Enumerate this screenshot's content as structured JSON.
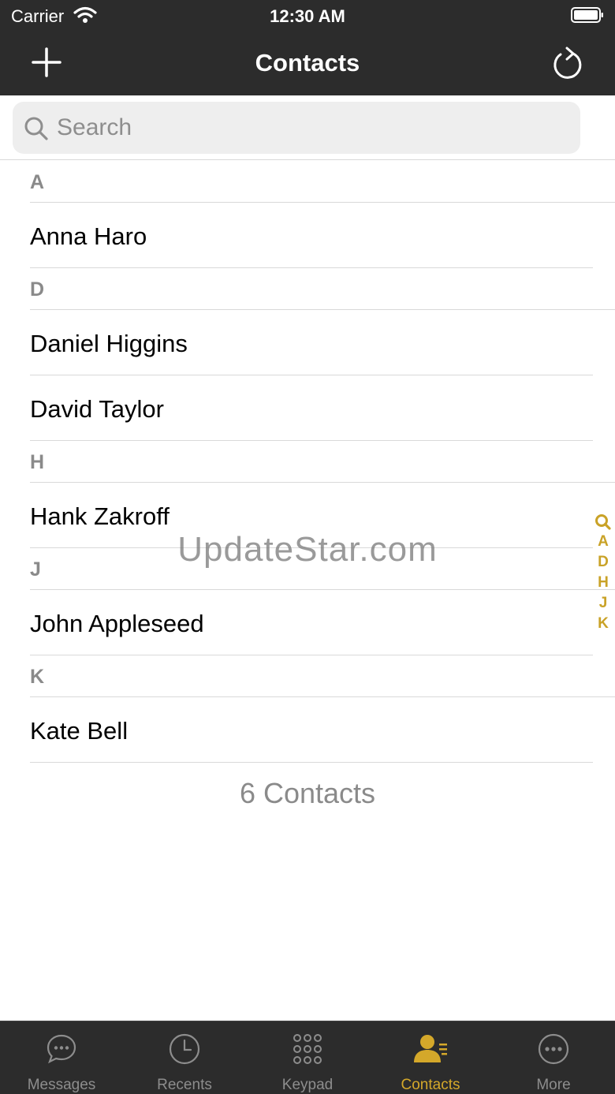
{
  "status_bar": {
    "carrier": "Carrier",
    "time": "12:30 AM"
  },
  "nav": {
    "title": "Contacts"
  },
  "search": {
    "placeholder": "Search",
    "value": ""
  },
  "sections": [
    {
      "letter": "A",
      "contacts": [
        "Anna Haro"
      ]
    },
    {
      "letter": "D",
      "contacts": [
        "Daniel Higgins",
        "David Taylor"
      ]
    },
    {
      "letter": "H",
      "contacts": [
        "Hank Zakroff"
      ]
    },
    {
      "letter": "J",
      "contacts": [
        "John Appleseed"
      ]
    },
    {
      "letter": "K",
      "contacts": [
        "Kate Bell"
      ]
    }
  ],
  "footer": {
    "count_label": "6 Contacts"
  },
  "index_letters": [
    "A",
    "D",
    "H",
    "J",
    "K"
  ],
  "watermark": "UpdateStar.com",
  "tabs": [
    {
      "label": "Messages",
      "icon": "chat-bubble-icon",
      "active": false
    },
    {
      "label": "Recents",
      "icon": "clock-icon",
      "active": false
    },
    {
      "label": "Keypad",
      "icon": "keypad-icon",
      "active": false
    },
    {
      "label": "Contacts",
      "icon": "contacts-icon",
      "active": true
    },
    {
      "label": "More",
      "icon": "more-icon",
      "active": false
    }
  ],
  "colors": {
    "bar_bg": "#2c2c2c",
    "accent": "#d4a82a",
    "index": "#c9a227",
    "separator": "#d9d9d9"
  }
}
